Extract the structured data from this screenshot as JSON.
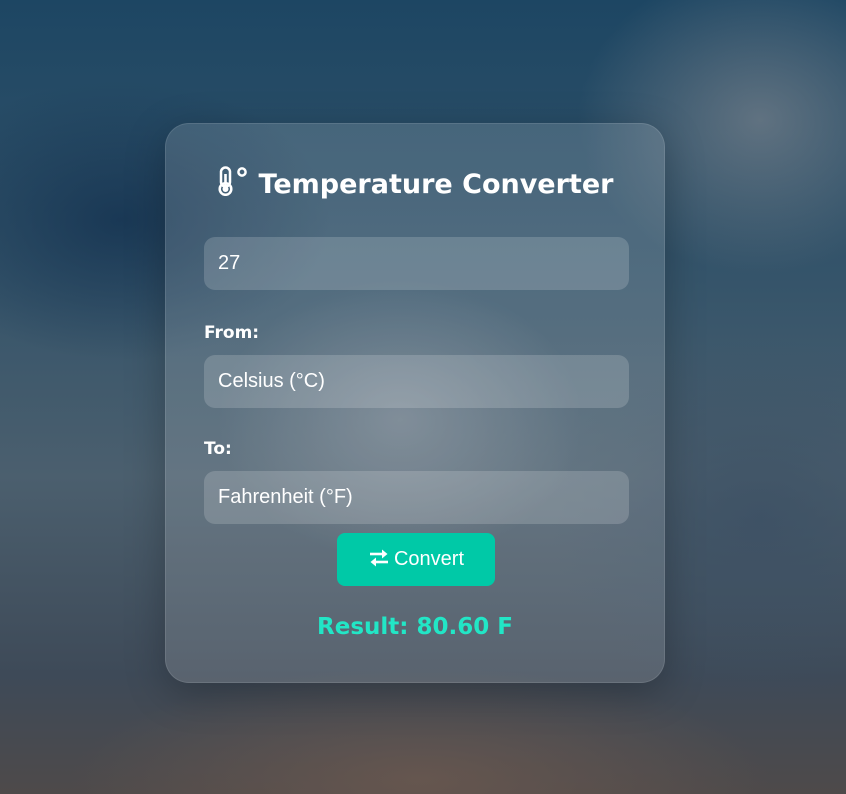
{
  "app": {
    "title": "Temperature Converter",
    "title_icon": "thermometer-icon"
  },
  "form": {
    "value_input": "27",
    "from_label": "From:",
    "from_selected": "Celsius (°C)",
    "to_label": "To:",
    "to_selected": "Fahrenheit (°F)",
    "convert_label": "Convert",
    "convert_icon": "swap-arrows-icon"
  },
  "result": {
    "text": "Result: 80.60 F"
  },
  "colors": {
    "accent": "#00c9a7",
    "result": "#22e6c6",
    "text": "#ffffff"
  }
}
